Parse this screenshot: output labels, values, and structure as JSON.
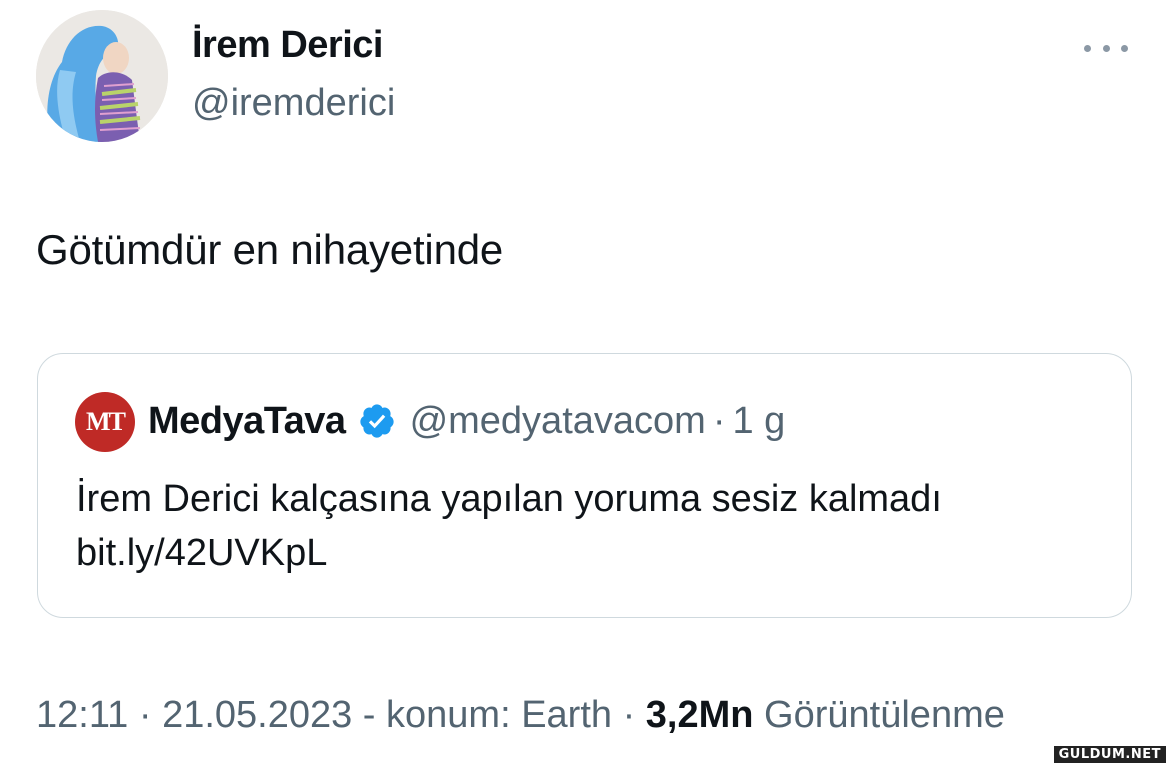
{
  "author": {
    "display_name": "İrem Derici",
    "handle": "@iremderici"
  },
  "tweet": {
    "text": "Götümdür en nihayetinde"
  },
  "quote": {
    "logo_text": "MT",
    "name": "MedyaTava",
    "handle": "@medyatavacom",
    "separator": "·",
    "time": "1 g",
    "text_line1": "İrem Derici kalçasına yapılan yoruma sesiz kalmadı",
    "text_line2": "bit.ly/42UVKpL"
  },
  "meta": {
    "time": "12:11",
    "sep1": " · ",
    "date": "21.05.2023",
    "location": " - konum: Earth",
    "sep2": " · ",
    "views_count": "3,2Mn",
    "views_label": " Görüntülenme"
  },
  "watermark": "GULDUM.NET",
  "colors": {
    "text": "#0f1419",
    "secondary": "#536471",
    "border": "#cfd9de",
    "verified": "#1d9bf0",
    "logo": "#bf2a26"
  },
  "icons": [
    "more-icon",
    "verified-icon"
  ]
}
